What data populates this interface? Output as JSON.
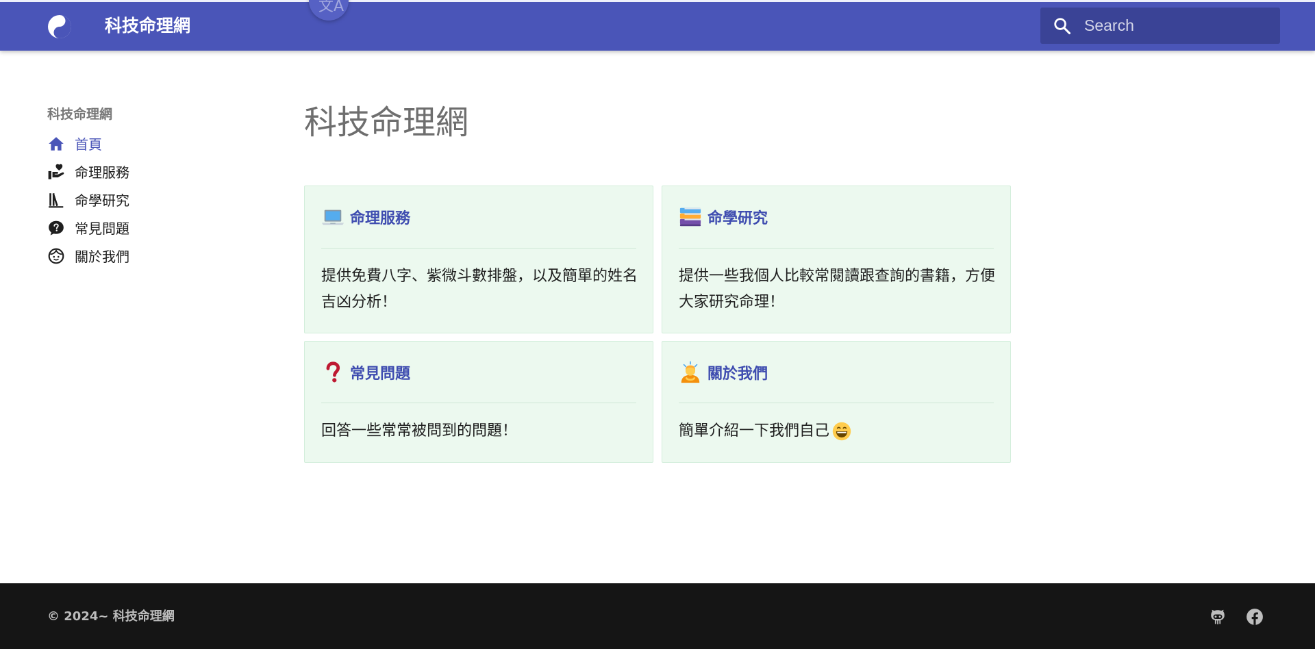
{
  "header": {
    "site_title": "科技命理網",
    "translate_glyph": "文A",
    "search_placeholder": "Search",
    "logo_icon": "yin-yang-icon",
    "search_icon": "search-icon"
  },
  "sidebar": {
    "heading": "科技命理網",
    "items": [
      {
        "label": "首頁",
        "icon": "home-icon",
        "active": true
      },
      {
        "label": "命理服務",
        "icon": "hand-heart-icon",
        "active": false
      },
      {
        "label": "命學研究",
        "icon": "library-books-icon",
        "active": false
      },
      {
        "label": "常見問題",
        "icon": "question-bubble-icon",
        "active": false
      },
      {
        "label": "關於我們",
        "icon": "face-icon",
        "active": false
      }
    ]
  },
  "main": {
    "page_title": "科技命理網",
    "cards": [
      {
        "title": "命理服務",
        "emoji": "laptop-icon",
        "description": "提供免費八字、紫微斗數排盤，以及簡單的姓名吉凶分析！"
      },
      {
        "title": "命學研究",
        "emoji": "books-icon",
        "description": "提供一些我個人比較常閱讀跟查詢的書籍，方便大家研究命理！"
      },
      {
        "title": "常見問題",
        "emoji": "red-question-mark-icon",
        "description": "回答一些常常被問到的問題！"
      },
      {
        "title": "關於我們",
        "emoji": "person-bowing-icon",
        "description": "簡單介紹一下我們自己",
        "trailing_emoji": "grinning-face-icon"
      }
    ]
  },
  "footer": {
    "copyright": "© 2024~ 科技命理網",
    "icons": [
      "github-icon",
      "facebook-icon"
    ]
  },
  "colors": {
    "header_bg": "#4a55b8",
    "accent": "#3f4db0",
    "card_bg": "#ecf9ef",
    "footer_bg": "#151515"
  }
}
